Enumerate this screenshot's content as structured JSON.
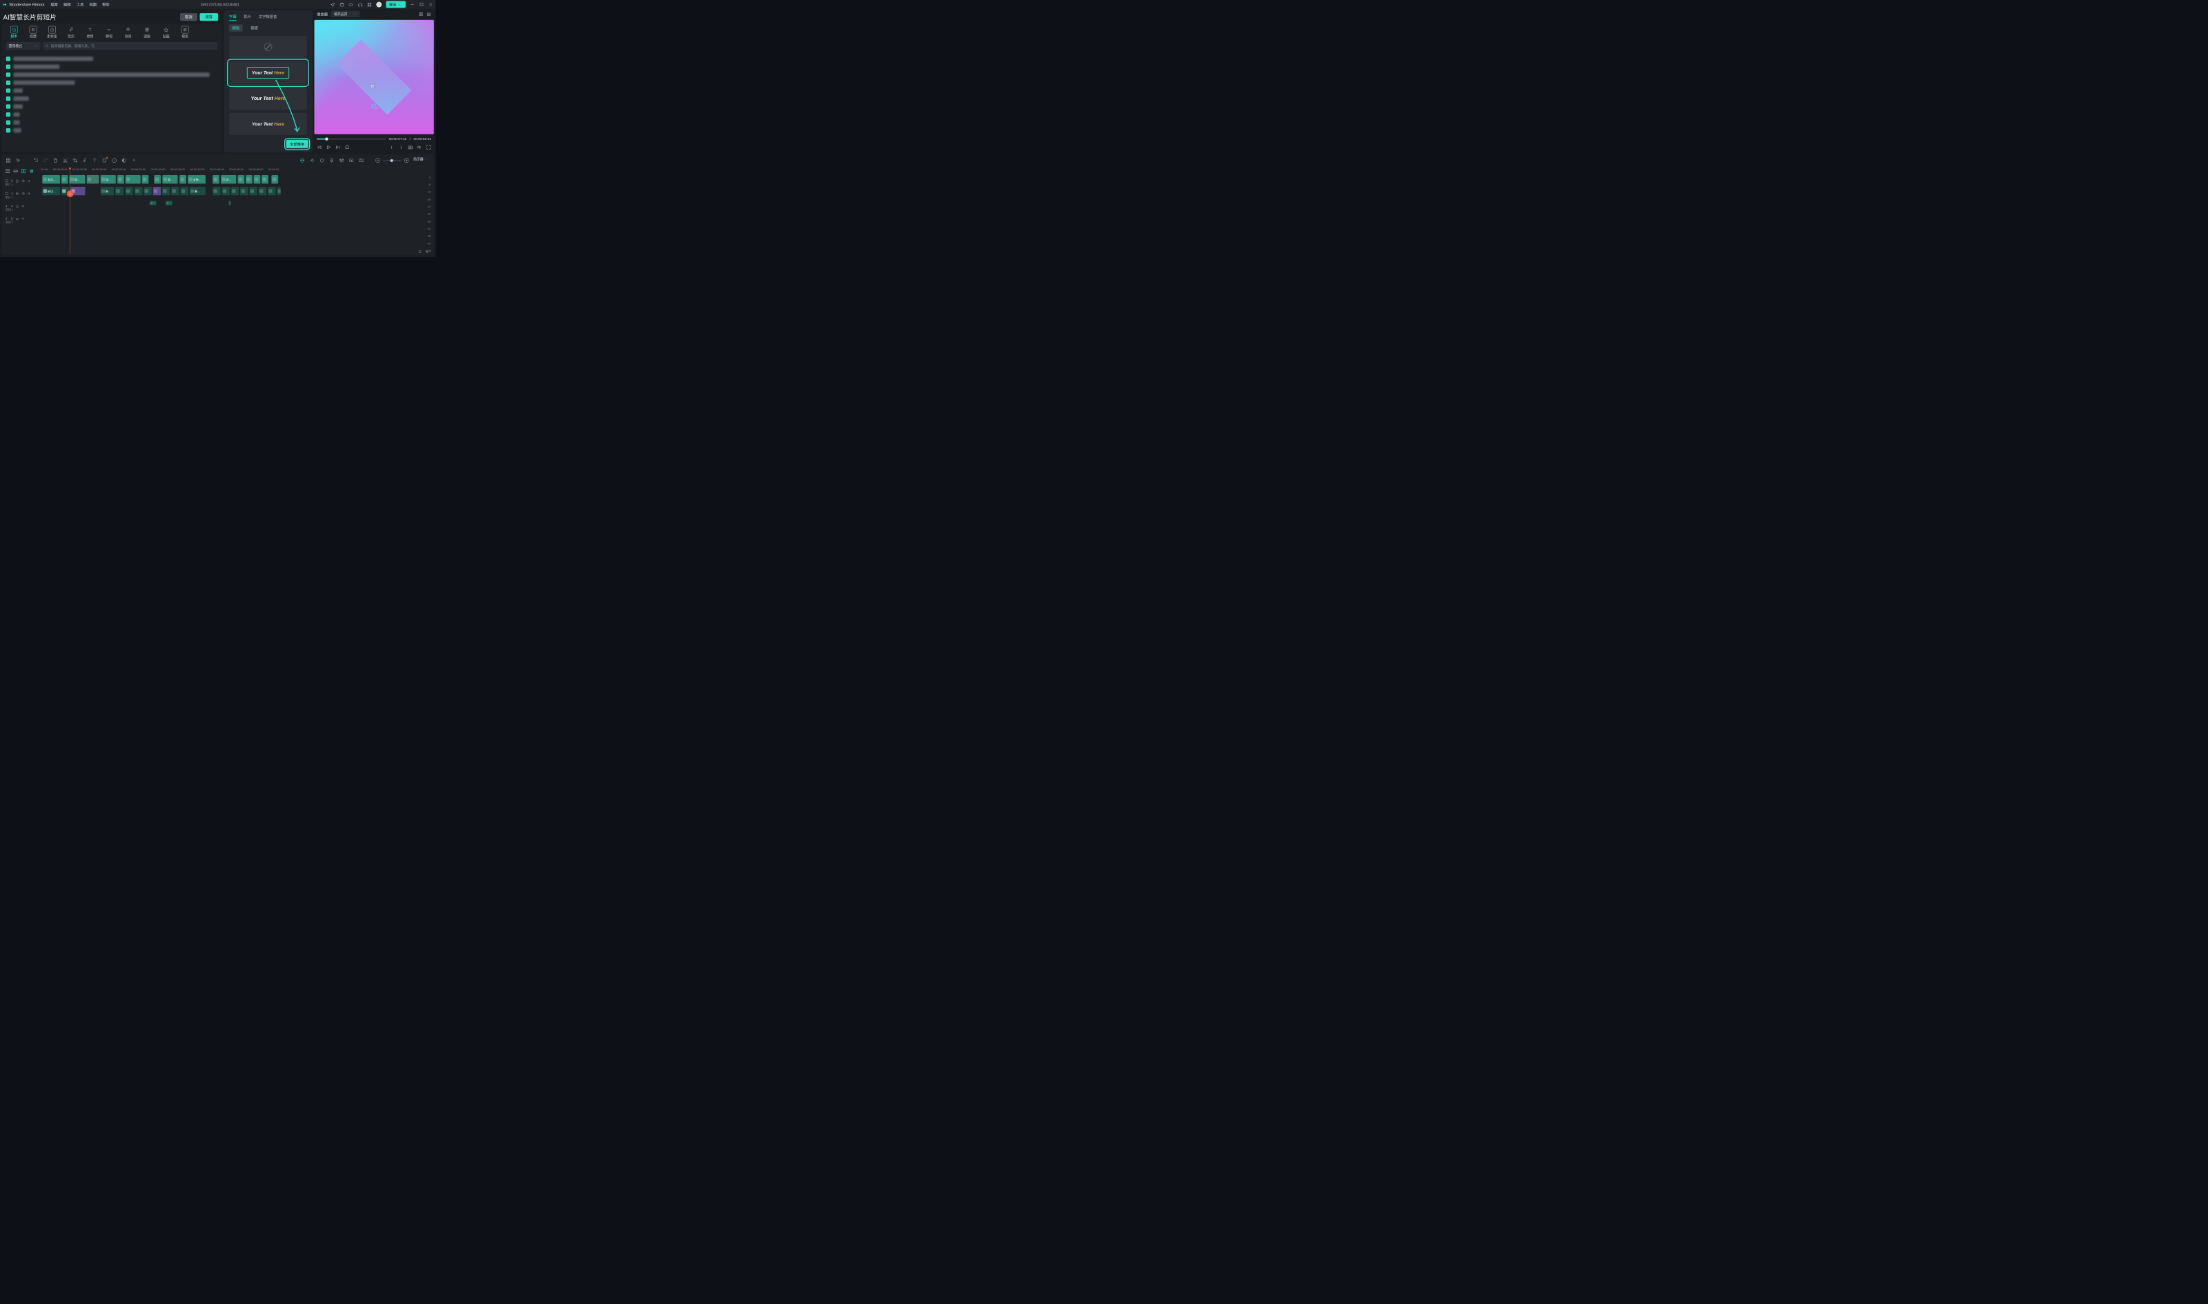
{
  "titlebar": {
    "app_name": "Wondershare Filmora",
    "menus": [
      "檔案",
      "編輯",
      "工具",
      "視圖",
      "幫助"
    ],
    "project_id": "1691747106103230481",
    "export_label": "導出"
  },
  "left": {
    "ai_title": "AI智慧长片剪短片",
    "cancel": "取消",
    "save": "保存",
    "categories": [
      {
        "label": "腳本",
        "active": true
      },
      {
        "label": "媒體"
      },
      {
        "label": "素材庫"
      },
      {
        "label": "音訊"
      },
      {
        "label": "標題"
      },
      {
        "label": "轉場"
      },
      {
        "label": "效果"
      },
      {
        "label": "濾鏡"
      },
      {
        "label": "貼圖"
      },
      {
        "label": "模板"
      }
    ],
    "mode_label": "選擇模式",
    "search_placeholder": "搜尋檔案名稱、螢幕元素、行",
    "script_count": 10
  },
  "mid": {
    "tabs": [
      {
        "label": "字幕",
        "active": true
      },
      {
        "label": "影片"
      },
      {
        "label": "文字轉語音"
      }
    ],
    "subtabs": [
      {
        "label": "模板",
        "active": true
      },
      {
        "label": "基礎"
      }
    ],
    "template_text_a": "Your Text ",
    "template_text_b": "Here",
    "apply_all": "全部應用"
  },
  "player": {
    "title": "播放器",
    "quality": "最高品質",
    "subtitle1": "按一",
    "subtitle2": "吗",
    "time_current": "00:00:07:11",
    "time_total": "00:00:59:01"
  },
  "timeline": {
    "indicator": "指示器",
    "timestamps": [
      "00:00",
      "00:00:05:00",
      "00:00:10:00",
      "00:00:15:00",
      "00:00:20:00",
      "00:00:25:00",
      "00:00:30:00",
      "00:00:35:00",
      "00:00:40:00",
      "00:00:45:00",
      "00:00:50:00",
      "00:00:55:00",
      "00:01:00"
    ],
    "tracks": [
      {
        "icon": "film",
        "idx": "2",
        "sub": "影片 2"
      },
      {
        "icon": "film",
        "idx": "1",
        "sub": "影片 1"
      },
      {
        "icon": "music",
        "idx": "1",
        "sub": "音訊 1"
      },
      {
        "icon": "music",
        "idx": "2",
        "sub": "音訊 2"
      }
    ],
    "clips_t": [
      "本次…",
      "惊…",
      "没…",
      "",
      "",
      "惊…",
      "",
      "支持…",
      "",
      "对…",
      "",
      "",
      ""
    ],
    "clips_v": [
      "新功…",
      "",
      "新…",
      "",
      "",
      "",
      "新…",
      "",
      "",
      "",
      "",
      "",
      ""
    ],
    "db": [
      0,
      -6,
      -12,
      -18,
      -24,
      -30,
      -36,
      -42,
      -48,
      -54
    ],
    "db_unit": "dB",
    "lr": [
      "左",
      "右"
    ]
  }
}
